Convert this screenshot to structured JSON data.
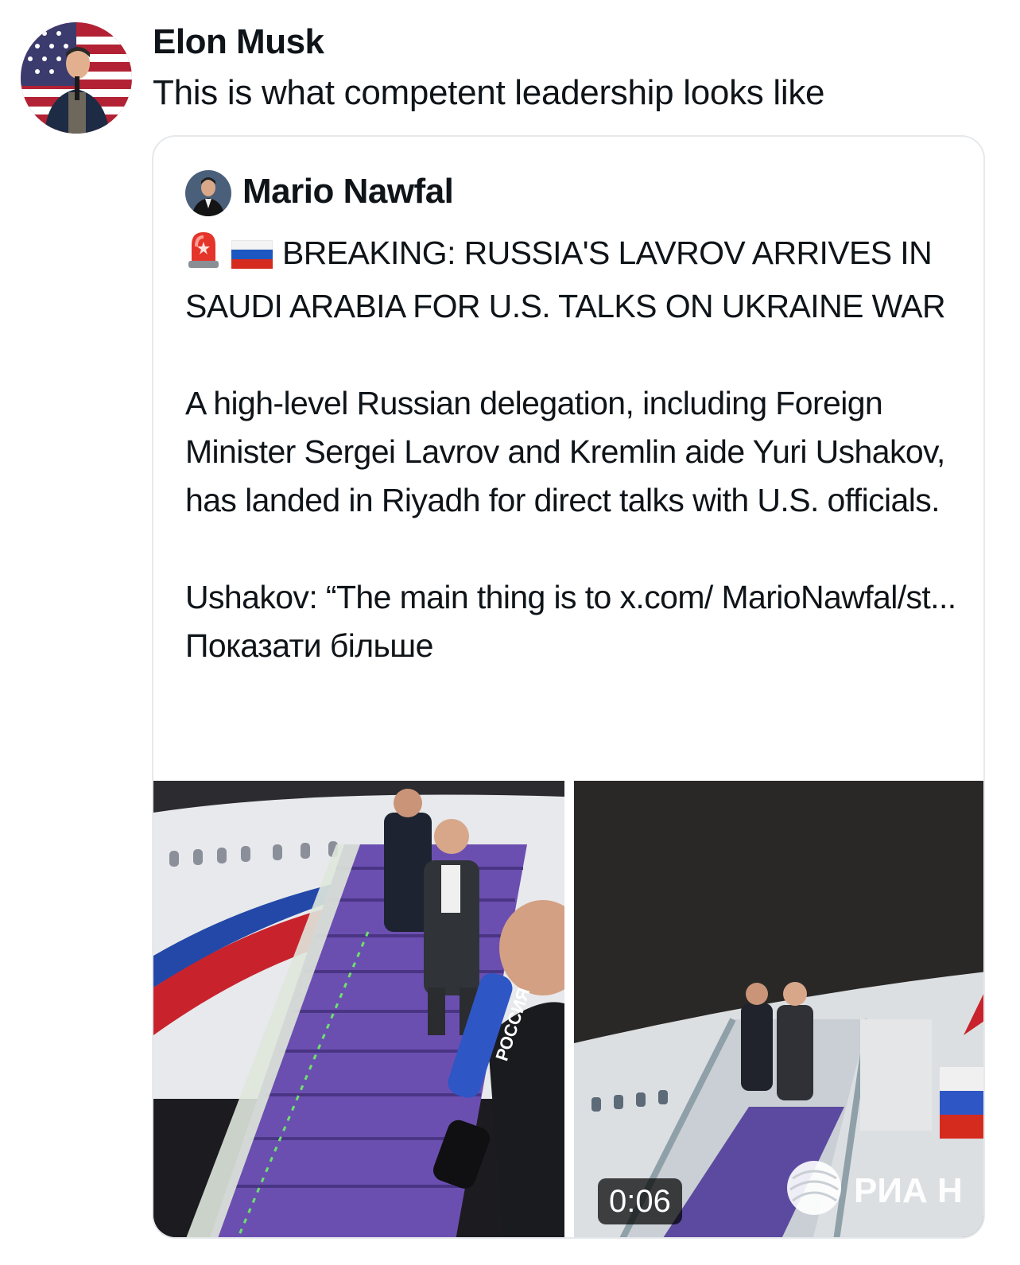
{
  "tweet": {
    "author_name": "Elon Musk",
    "avatar_icon": "avatar-photo",
    "text": "This is what competent leadership looks like"
  },
  "quoted": {
    "author_name": "Mario Nawfal",
    "avatar_icon": "avatar-photo",
    "headline_icons": [
      "siren-emoji",
      "russia-flag-emoji"
    ],
    "headline": "BREAKING: RUSSIA'S LAVROV ARRIVES IN SAUDI ARABIA FOR U.S. TALKS ON UKRAINE WAR",
    "paragraph1": "A high-level Russian delegation, including Foreign Minister Sergei Lavrov and Kremlin aide Yuri Ushakov, has landed in Riyadh for direct talks with U.S. officials.",
    "paragraph2": "Ushakov: “The main thing is to x.com/ MarioNawfal/st...",
    "show_more": "Показати більше",
    "media": [
      {
        "kind": "image",
        "description_icon": "photo-icon"
      },
      {
        "kind": "video",
        "duration": "0:06",
        "watermark": "РИА Н",
        "microphone_text": "РОССИЯ"
      }
    ]
  },
  "colors": {
    "text": "#0f1419",
    "card_border": "#e6e9ec",
    "stair_purple": "#6b4fb0"
  }
}
